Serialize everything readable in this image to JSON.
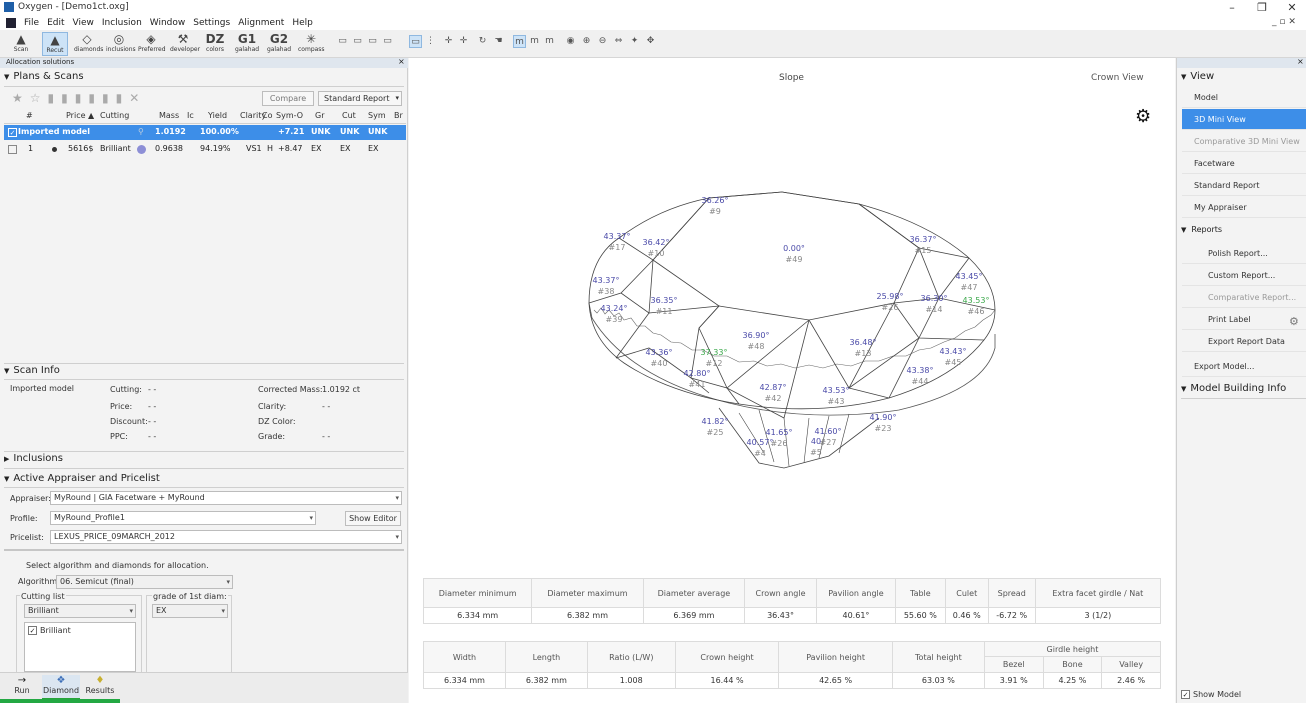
{
  "window": {
    "title": "Oxygen - [Demo1ct.oxg]"
  },
  "menu": [
    "File",
    "Edit",
    "View",
    "Inclusion",
    "Window",
    "Settings",
    "Alignment",
    "Help"
  ],
  "toolbar": [
    {
      "icon": "scan-icon",
      "glyph": "▲",
      "label": "Scan"
    },
    {
      "icon": "recut-icon",
      "glyph": "▲",
      "label": "Recut",
      "selected": true
    },
    {
      "icon": "diamonds-icon",
      "glyph": "◇",
      "label": "diamonds"
    },
    {
      "icon": "inclusions-icon",
      "glyph": "◎",
      "label": "inclusions"
    },
    {
      "icon": "preferred-icon",
      "glyph": "◈",
      "label": "Preferred"
    },
    {
      "icon": "developer-icon",
      "glyph": "⚒",
      "label": "developer"
    },
    {
      "icon": "dz-icon",
      "glyph": "DZ",
      "label": "colors"
    },
    {
      "icon": "g1-icon",
      "glyph": "G1",
      "label": "galahad"
    },
    {
      "icon": "g2-icon",
      "glyph": "G2",
      "label": "galahad"
    },
    {
      "icon": "compass-icon",
      "glyph": "✳",
      "label": "compass"
    }
  ],
  "left": {
    "allocation_title": "Allocation solutions",
    "plans_title": "Plans & Scans",
    "compare_label": "Compare",
    "report_label": "Standard Report",
    "columns": [
      "#",
      "Price ▲",
      "Cutting",
      "Mass",
      "Ic",
      "Yield",
      "Clarity",
      "Co",
      "Sym-O",
      "Gr",
      "Cut",
      "Sym",
      "Br"
    ],
    "rows": [
      {
        "num": "",
        "price": "",
        "cutting": "Imported model",
        "mass": "1.0192",
        "ic": "",
        "yield": "100.00%",
        "clarity": "",
        "co": "",
        "symo": "+7.21",
        "gr": "UNK",
        "cut": "UNK",
        "sym": "UNK",
        "selected": true
      },
      {
        "num": "1",
        "price": "5616$",
        "cutting": "Brilliant",
        "mass": "0.9638",
        "ic": "",
        "yield": "94.19%",
        "clarity": "VS1",
        "co": "H",
        "symo": "+8.47",
        "gr": "EX",
        "cut": "EX",
        "sym": "EX",
        "selected": false
      }
    ],
    "scan_info_title": "Scan Info",
    "scan_info": {
      "name": "Imported model",
      "cutting_label": "Cutting:",
      "cutting_val": "- -",
      "price_label": "Price:",
      "price_val": "- -",
      "discount_label": "Discount:",
      "discount_val": "- -",
      "ppc_label": "PPC:",
      "ppc_val": "- -",
      "cmass_label": "Corrected Mass:",
      "cmass_val": "1.0192 ct",
      "clarity_label": "Clarity:",
      "clarity_val": "- -",
      "dzcolor_label": "DZ Color:",
      "dzcolor_val": "",
      "grade_label": "Grade:",
      "grade_val": "- -"
    },
    "inclusions_title": "Inclusions",
    "appraiser_title": "Active Appraiser and Pricelist",
    "appraiser_label": "Appraiser:",
    "appraiser_val": "MyRound | GIA Facetware + MyRound",
    "profile_label": "Profile:",
    "profile_val": "MyRound_Profile1",
    "show_editor": "Show Editor",
    "pricelist_label": "Pricelist:",
    "pricelist_val": "LEXUS_PRICE_09MARCH_2012",
    "select_text": "Select algorithm and diamonds for allocation.",
    "algorithm_label": "Algorithm:",
    "algorithm_val": "06. Semicut (final)",
    "cutting_list_label": "Cutting list",
    "cutting_list_val": "Brilliant",
    "grade_label": "grade of 1st diam:",
    "grade_val": "EX",
    "cutting_check": "Brilliant",
    "bottom_tabs": [
      "Run",
      "Diamond",
      "Results"
    ]
  },
  "center": {
    "slope_label": "Slope",
    "crown_view_label": "Crown View",
    "facets": [
      {
        "angle": "36.26°",
        "id": "#9"
      },
      {
        "angle": "43.37°",
        "id": "#17"
      },
      {
        "angle": "36.42°",
        "id": "#10"
      },
      {
        "angle": "0.00°",
        "id": "#49"
      },
      {
        "angle": "36.37°",
        "id": "#15"
      },
      {
        "angle": "43.45°",
        "id": "#47"
      },
      {
        "angle": "43.53°",
        "id": "#46"
      },
      {
        "angle": "43.37°",
        "id": "#38"
      },
      {
        "angle": "43.24°",
        "id": "#39"
      },
      {
        "angle": "36.35°",
        "id": "#11"
      },
      {
        "angle": "25.98°",
        "id": "#26"
      },
      {
        "angle": "36.30°",
        "id": "#14"
      },
      {
        "angle": "36.90°",
        "id": "#48"
      },
      {
        "angle": "36.48°",
        "id": "#13"
      },
      {
        "angle": "43.36°",
        "id": "#40"
      },
      {
        "angle": "37.33°",
        "id": "#12"
      },
      {
        "angle": "43.43°",
        "id": "#45"
      },
      {
        "angle": "42.80°",
        "id": "#41"
      },
      {
        "angle": "43.38°",
        "id": "#44"
      },
      {
        "angle": "42.87°",
        "id": "#42"
      },
      {
        "angle": "43.53°",
        "id": "#43"
      },
      {
        "angle": "41.82°",
        "id": "#25"
      },
      {
        "angle": "41.90°",
        "id": "#23"
      },
      {
        "angle": "41.65°",
        "id": "#26"
      },
      {
        "angle": "41.60°",
        "id": "#27"
      },
      {
        "angle": "40.57°",
        "id": "#4"
      },
      {
        "angle": "40",
        "id": "#5"
      }
    ],
    "measurements1": {
      "headers": [
        "Diameter minimum",
        "Diameter maximum",
        "Diameter average",
        "Crown angle",
        "Pavilion angle",
        "Table",
        "Culet",
        "Spread",
        "Extra facet girdle / Nat"
      ],
      "values": [
        "6.334 mm",
        "6.382 mm",
        "6.369 mm",
        "36.43°",
        "40.61°",
        "55.60 %",
        "0.46 %",
        "-6.72 %",
        "3 (1/2)"
      ]
    },
    "measurements2": {
      "headers": [
        "Width",
        "Length",
        "Ratio (L/W)",
        "Crown height",
        "Pavilion height",
        "Total height"
      ],
      "girdle_header": "Girdle height",
      "girdle_sub": [
        "Bezel",
        "Bone",
        "Valley"
      ],
      "values": [
        "6.334 mm",
        "6.382 mm",
        "1.008",
        "16.44 %",
        "42.65 %",
        "63.03 %",
        "3.91 %",
        "4.25 %",
        "2.46 %"
      ]
    }
  },
  "right": {
    "view_title": "View",
    "items": [
      {
        "label": "Model",
        "state": "normal",
        "sub": false
      },
      {
        "label": "3D Mini View",
        "state": "selected",
        "sub": false
      },
      {
        "label": "Comparative 3D Mini View",
        "state": "disabled",
        "sub": false
      },
      {
        "label": "Facetware",
        "state": "normal",
        "sub": false
      },
      {
        "label": "Standard Report",
        "state": "normal",
        "sub": false
      },
      {
        "label": "My Appraiser",
        "state": "normal",
        "sub": false
      }
    ],
    "reports_title": "Reports",
    "report_items": [
      {
        "label": "Polish Report...",
        "state": "normal"
      },
      {
        "label": "Custom Report...",
        "state": "normal"
      },
      {
        "label": "Comparative Report...",
        "state": "disabled"
      },
      {
        "label": "Print Label",
        "state": "normal"
      },
      {
        "label": "Export Report Data",
        "state": "normal"
      }
    ],
    "export_model": "Export Model...",
    "model_building_title": "Model Building Info",
    "show_model": "Show Model"
  },
  "colors": {
    "accent": "#3d8ee8",
    "facet_label": "#4a4aa8",
    "facet_green": "#3aa84a"
  }
}
